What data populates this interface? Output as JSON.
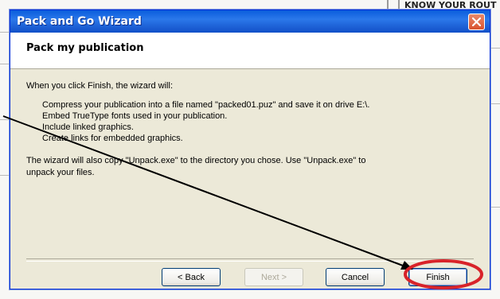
{
  "background": {
    "right_text": "KNOW YOUR ROUT"
  },
  "dialog": {
    "title": "Pack and Go Wizard",
    "header": "Pack my publication",
    "intro": "When you click Finish, the wizard will:",
    "bullets": [
      "Compress your publication into a file named \"packed01.puz\" and save it on drive E:\\.",
      "Embed TrueType fonts used in your publication.",
      "Include linked graphics.",
      "Create links for embedded graphics."
    ],
    "note_line1": "The wizard will also copy \"Unpack.exe\" to the directory you chose.  Use \"Unpack.exe\" to",
    "note_line2": "unpack your files.",
    "buttons": {
      "back": "< Back",
      "next": "Next >",
      "cancel": "Cancel",
      "finish": "Finish"
    }
  },
  "annotation": {
    "arrow_color": "#000000",
    "highlight_color": "#d8232a"
  }
}
